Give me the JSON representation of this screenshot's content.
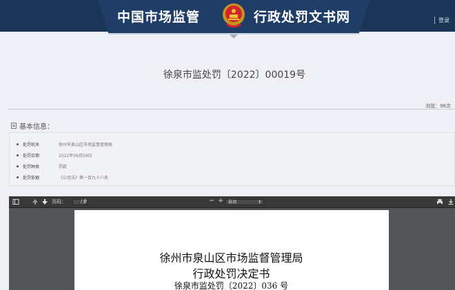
{
  "header": {
    "title_left": "中国市场监管",
    "title_right": "行政处罚文书网",
    "login_label": "登录",
    "colors": {
      "bar": "#1b3557",
      "tab": "#1f3d66"
    }
  },
  "document": {
    "title": "徐泉市监处罚〔2022〕00019号",
    "views_text": "浏览：96次"
  },
  "basic_info": {
    "heading": "基本信息：",
    "rows": [
      {
        "label": "处罚机关",
        "value": "徐州市泉山区市场监督管理局"
      },
      {
        "label": "处罚日期",
        "value": "2022年06月09日"
      },
      {
        "label": "处罚种类",
        "value": "罚款"
      },
      {
        "label": "处罚依据",
        "value": "《公司法》第一百九十八条"
      }
    ]
  },
  "pdf_viewer": {
    "page_label": "页码：",
    "current_page": "1",
    "total_pages": "/ 9",
    "zoom_value": "自动",
    "zoom_out": "−",
    "zoom_in": "+",
    "content": {
      "line1": "徐州市泉山区市场监督管理局",
      "line2": "行政处罚决定书",
      "line3": "徐泉市监处罚〔2022〕036 号"
    }
  }
}
